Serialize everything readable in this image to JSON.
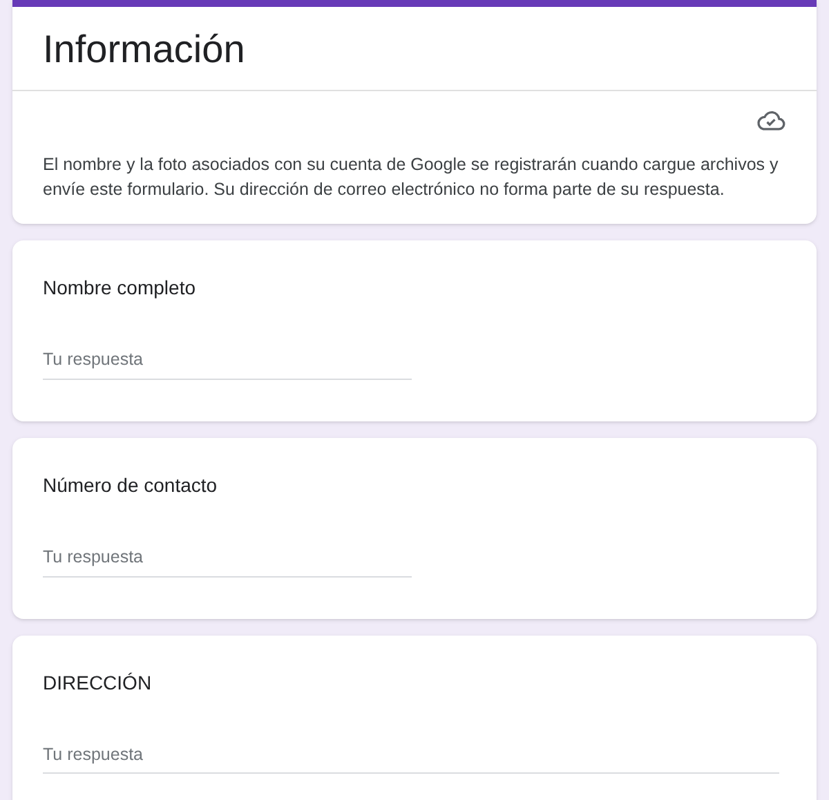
{
  "header": {
    "title": "Información",
    "description": "El nombre y la foto asociados con su cuenta de Google se registrarán cuando cargue archivos y envíe este formulario. Su dirección de correo electrónico no forma parte de su respuesta."
  },
  "questions": [
    {
      "label": "Nombre completo",
      "kind": "short",
      "placeholder": "Tu respuesta"
    },
    {
      "label": "Número de contacto",
      "kind": "short",
      "placeholder": "Tu respuesta"
    },
    {
      "label": "DIRECCIÓN",
      "kind": "long",
      "placeholder": "Tu respuesta"
    }
  ]
}
